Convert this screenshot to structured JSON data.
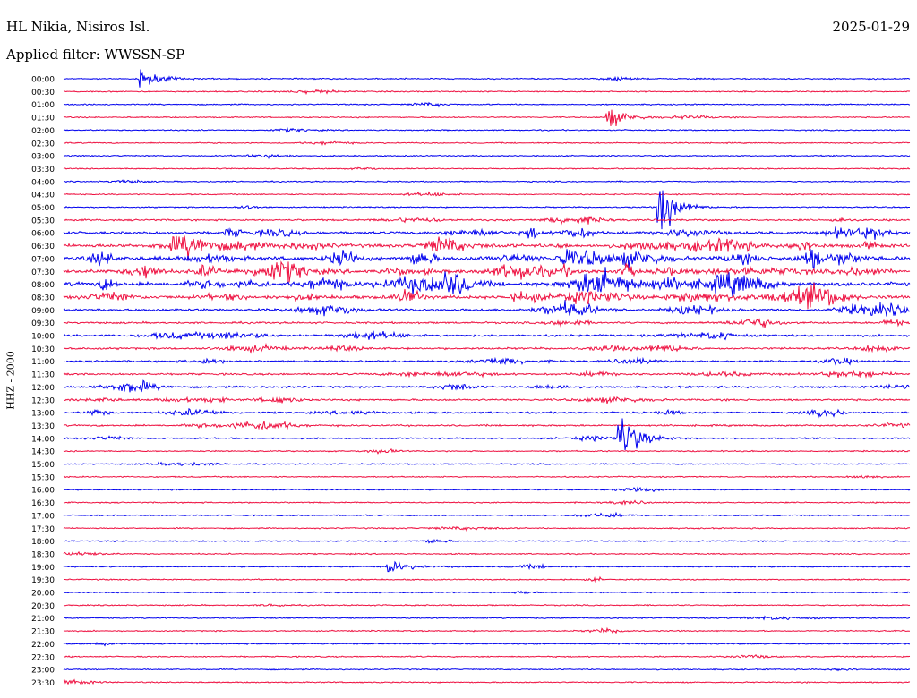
{
  "header": {
    "station": "HL Nikia, Nisiros Isl.",
    "date": "2025-01-29",
    "filter": "Applied filter: WWSSN-SP",
    "channel": "HHZ - 2000"
  },
  "colors": {
    "even": "#0000ee",
    "odd": "#ee1040"
  },
  "chart_data": {
    "type": "line",
    "title": "HL Nikia, Nisiros Isl.",
    "subtitle": "Applied filter: WWSSN-SP",
    "ylabel": "HHZ - 2000",
    "grid": false,
    "rows": [
      "00:00",
      "00:30",
      "01:00",
      "01:30",
      "02:00",
      "02:30",
      "03:00",
      "03:30",
      "04:00",
      "04:30",
      "05:00",
      "05:30",
      "06:00",
      "06:30",
      "07:00",
      "07:30",
      "08:00",
      "08:30",
      "09:00",
      "09:30",
      "10:00",
      "10:30",
      "11:00",
      "11:30",
      "12:00",
      "12:30",
      "13:00",
      "13:30",
      "14:00",
      "14:30",
      "15:00",
      "15:30",
      "16:00",
      "16:30",
      "17:00",
      "17:30",
      "18:00",
      "18:30",
      "19:00",
      "19:30",
      "20:00",
      "20:30",
      "21:00",
      "21:30",
      "22:00",
      "22:30",
      "23:00",
      "23:30"
    ],
    "x_range_minutes": [
      0,
      30
    ],
    "row_activity": [
      0.05,
      0.04,
      0.05,
      0.04,
      0.05,
      0.04,
      0.04,
      0.04,
      0.04,
      0.04,
      0.05,
      0.2,
      0.45,
      0.7,
      0.8,
      0.75,
      0.85,
      0.7,
      0.4,
      0.25,
      0.3,
      0.3,
      0.25,
      0.25,
      0.3,
      0.25,
      0.25,
      0.2,
      0.1,
      0.06,
      0.05,
      0.05,
      0.05,
      0.05,
      0.05,
      0.05,
      0.05,
      0.05,
      0.05,
      0.05,
      0.05,
      0.05,
      0.05,
      0.05,
      0.05,
      0.05,
      0.05,
      0.05
    ],
    "events": [
      {
        "row": "00:00",
        "minute": 2.7,
        "amplitude": 0.25
      },
      {
        "row": "01:30",
        "minute": 19.3,
        "amplitude": 0.3
      },
      {
        "row": "05:00",
        "minute": 21.1,
        "amplitude": 1.0,
        "note": "large spike with coda"
      },
      {
        "row": "14:00",
        "minute": 19.7,
        "amplitude": 0.7,
        "note": "event with coda"
      },
      {
        "row": "19:00",
        "minute": 11.5,
        "amplitude": 0.2
      }
    ]
  }
}
